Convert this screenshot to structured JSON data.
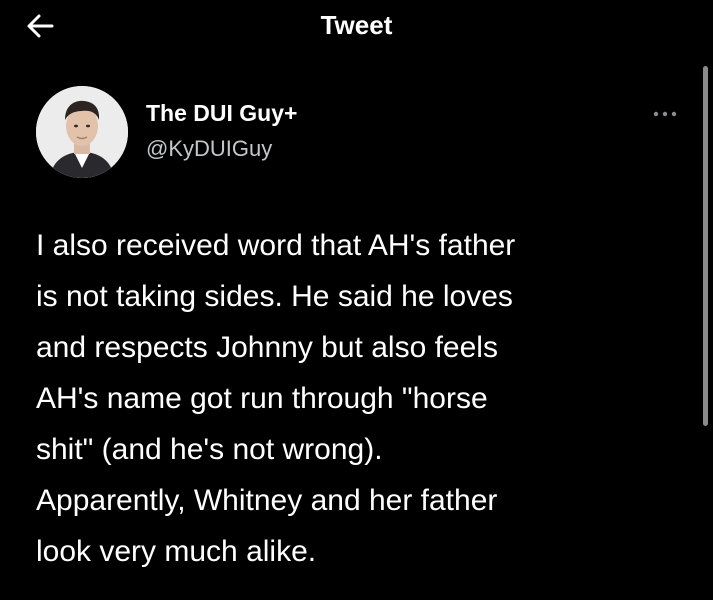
{
  "header": {
    "title": "Tweet",
    "back_icon": "arrow-left-icon"
  },
  "author": {
    "display_name": "The DUI Guy+",
    "handle": "@KyDUIGuy",
    "avatar_icon": "avatar-photo"
  },
  "menu": {
    "more_icon": "more-options-icon"
  },
  "tweet": {
    "lines": [
      "I also received word that AH's father",
      "is not taking sides. He said he loves",
      "and respects Johnny but also feels",
      "AH's name got run through \"horse",
      "shit\" (and he's not wrong).",
      "Apparently, Whitney and her father",
      "look very much alike."
    ]
  },
  "colors": {
    "background": "#000000",
    "text": "#ffffff",
    "secondary_text": "#c4c7ca"
  }
}
